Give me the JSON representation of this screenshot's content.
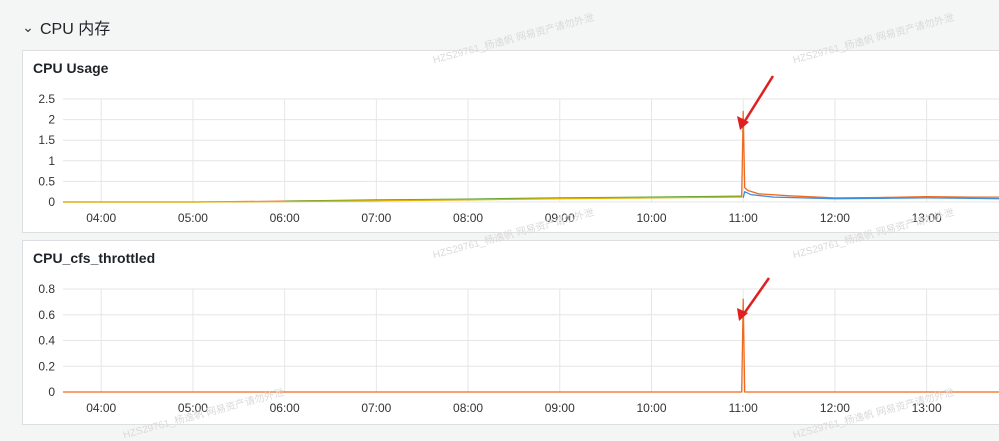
{
  "row": {
    "title": "CPU 内存",
    "chevron_icon": "chevron-down-icon"
  },
  "panels": [
    {
      "title": "CPU Usage"
    },
    {
      "title": "CPU_cfs_throttled"
    }
  ],
  "watermark_text": "HZS29761_杨逸帆 网易资产请勿外泄",
  "colors": {
    "series_orange": "#ef6a1f",
    "series_blue": "#3f8fdc",
    "series_green": "#5ba33a",
    "series_yellow": "#e0b400",
    "annotation_red": "#e02020",
    "grid": "#e6e6e6"
  },
  "chart_data": [
    {
      "type": "line",
      "title": "CPU Usage",
      "x_ticks": [
        "04:00",
        "05:00",
        "06:00",
        "07:00",
        "08:00",
        "09:00",
        "10:00",
        "11:00",
        "12:00",
        "13:00"
      ],
      "y_ticks": [
        "0",
        "0.5",
        "1",
        "1.5",
        "2",
        "2.5"
      ],
      "ylim": [
        0,
        2.5
      ],
      "xlim": [
        "03:35",
        "13:48"
      ],
      "grid": true,
      "series": [
        {
          "color": "#ef6a1f",
          "x": [
            "03:35",
            "05:00",
            "06:00",
            "07:00",
            "08:00",
            "09:00",
            "10:00",
            "10:59",
            "11:00",
            "11:01",
            "11:03",
            "11:10",
            "11:30",
            "12:00",
            "12:30",
            "13:00",
            "13:30",
            "13:48"
          ],
          "values": [
            0.0,
            0.0,
            0.02,
            0.04,
            0.06,
            0.09,
            0.11,
            0.13,
            2.2,
            0.35,
            0.28,
            0.2,
            0.15,
            0.1,
            0.11,
            0.13,
            0.12,
            0.12
          ]
        },
        {
          "color": "#3f8fdc",
          "x": [
            "11:00",
            "11:01",
            "11:05",
            "11:20",
            "12:00",
            "12:30",
            "13:00",
            "13:30",
            "13:48"
          ],
          "values": [
            0.1,
            0.25,
            0.18,
            0.12,
            0.08,
            0.09,
            0.1,
            0.09,
            0.08
          ]
        },
        {
          "color": "#5ba33a",
          "x": [
            "06:00",
            "07:00",
            "08:00",
            "09:00",
            "10:00",
            "10:59"
          ],
          "values": [
            0.02,
            0.05,
            0.07,
            0.1,
            0.12,
            0.14
          ]
        },
        {
          "color": "#e0b400",
          "x": [
            "03:35",
            "05:00",
            "06:00",
            "07:00",
            "08:00",
            "09:00",
            "10:00",
            "10:59"
          ],
          "values": [
            0.0,
            0.0,
            0.01,
            0.03,
            0.05,
            0.08,
            0.1,
            0.12
          ]
        }
      ]
    },
    {
      "type": "line",
      "title": "CPU_cfs_throttled",
      "x_ticks": [
        "04:00",
        "05:00",
        "06:00",
        "07:00",
        "08:00",
        "09:00",
        "10:00",
        "11:00",
        "12:00",
        "13:00"
      ],
      "y_ticks": [
        "0",
        "0.2",
        "0.4",
        "0.6",
        "0.8"
      ],
      "ylim": [
        0,
        0.8
      ],
      "xlim": [
        "03:35",
        "13:48"
      ],
      "grid": true,
      "series": [
        {
          "color": "#ef6a1f",
          "x": [
            "03:35",
            "10:59",
            "11:00",
            "11:00",
            "11:01",
            "13:48"
          ],
          "values": [
            0,
            0,
            0.72,
            0.72,
            0,
            0
          ]
        }
      ]
    }
  ]
}
